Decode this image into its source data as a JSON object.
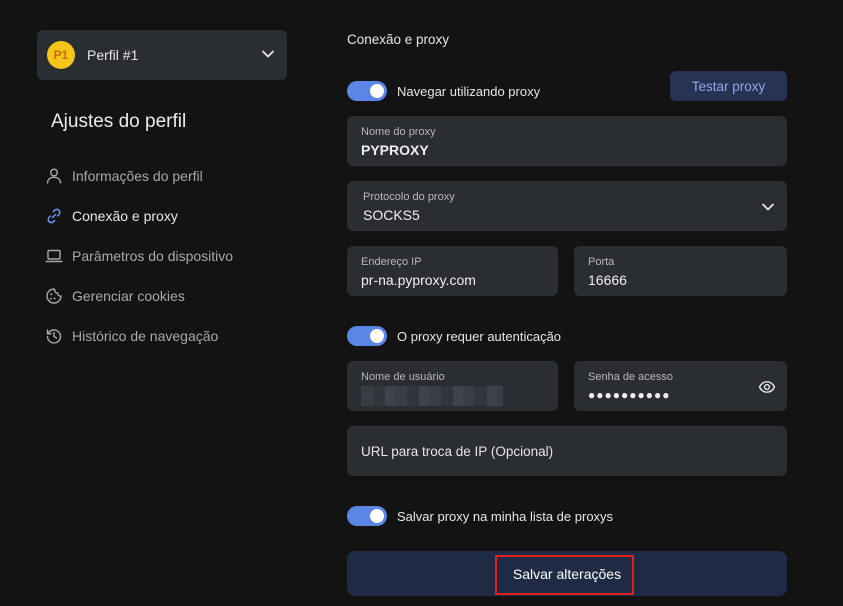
{
  "sidebar": {
    "profile": {
      "avatar_text": "P1",
      "name": "Perfil #1",
      "avatar_color": "#f5c518"
    },
    "title": "Ajustes do perfil",
    "items": [
      {
        "label": "Informações do perfil",
        "icon": "user-icon"
      },
      {
        "label": "Conexão e proxy",
        "icon": "link-icon",
        "active": true
      },
      {
        "label": "Parâmetros do dispositivo",
        "icon": "laptop-icon"
      },
      {
        "label": "Gerenciar cookies",
        "icon": "cookie-icon"
      },
      {
        "label": "Histórico de navegação",
        "icon": "history-icon"
      }
    ]
  },
  "main": {
    "title": "Conexão e proxy",
    "use_proxy_toggle": {
      "label": "Navegar utilizando proxy",
      "on": true
    },
    "test_button": "Testar proxy",
    "proxy_name": {
      "label": "Nome do proxy",
      "value": "PYPROXY"
    },
    "protocol": {
      "label": "Protocolo do proxy",
      "value": "SOCKS5"
    },
    "ip": {
      "label": "Endereço IP",
      "value": "pr-na.pyproxy.com"
    },
    "port": {
      "label": "Porta",
      "value": "16666"
    },
    "auth_toggle": {
      "label": "O proxy requer autenticação",
      "on": true
    },
    "username": {
      "label": "Nome de usuário"
    },
    "password": {
      "label": "Senha de acesso",
      "value": "●●●●●●●●●●"
    },
    "change_ip_url": {
      "placeholder": "URL para troca de IP (Opcional)"
    },
    "save_list_toggle": {
      "label": "Salvar proxy na minha lista de proxys",
      "on": true
    },
    "save_button": "Salvar alterações"
  },
  "colors": {
    "accent": "#5b86e5",
    "background": "#131313",
    "field": "#2a2d31",
    "highlight": "#e0201e"
  }
}
